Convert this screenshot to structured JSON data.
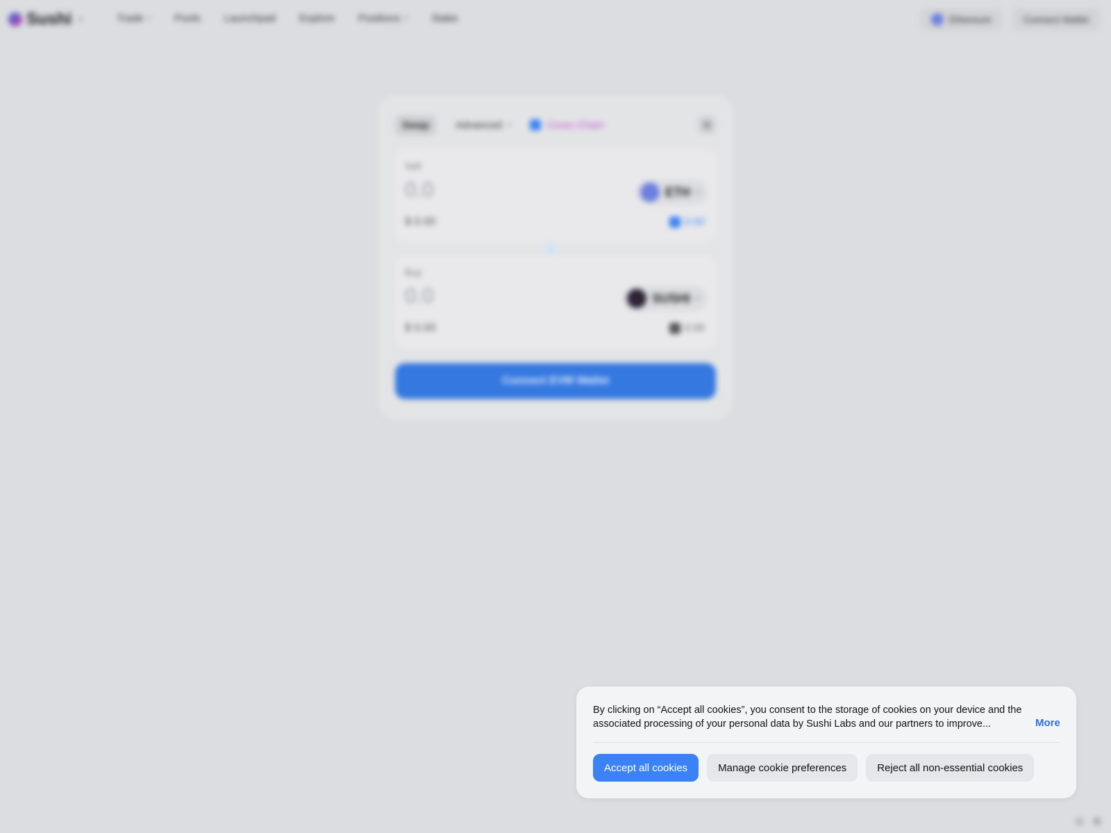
{
  "nav": {
    "brand": "Sushi",
    "links": [
      "Trade",
      "Pools",
      "Launchpad",
      "Explore",
      "Positions",
      "Stake"
    ],
    "chain": "Ethereum",
    "connect": "Connect Wallet"
  },
  "swap": {
    "tabs": {
      "swap": "Swap",
      "advanced": "Advanced",
      "cross_chain": "Cross Chain"
    },
    "sell": {
      "label": "Sell",
      "amount": "0.0",
      "token": "ETH",
      "usd": "$ 0.00",
      "balance": "0.00"
    },
    "buy": {
      "label": "Buy",
      "amount": "0.0",
      "token": "SUSHI",
      "usd": "$ 0.00",
      "balance": "0.00"
    },
    "cta": "Connect EVM Wallet"
  },
  "cookie": {
    "text": "By clicking on “Accept all cookies”, you consent to the storage of cookies on your device and the associated processing of your personal data by Sushi Labs and our partners to improve...",
    "more": "More",
    "accept": "Accept all cookies",
    "manage": "Manage cookie preferences",
    "reject": "Reject all non-essential cookies"
  },
  "colors": {
    "accent": "#3b82f6",
    "cta": "#3478e0",
    "background": "#dcdde0"
  }
}
